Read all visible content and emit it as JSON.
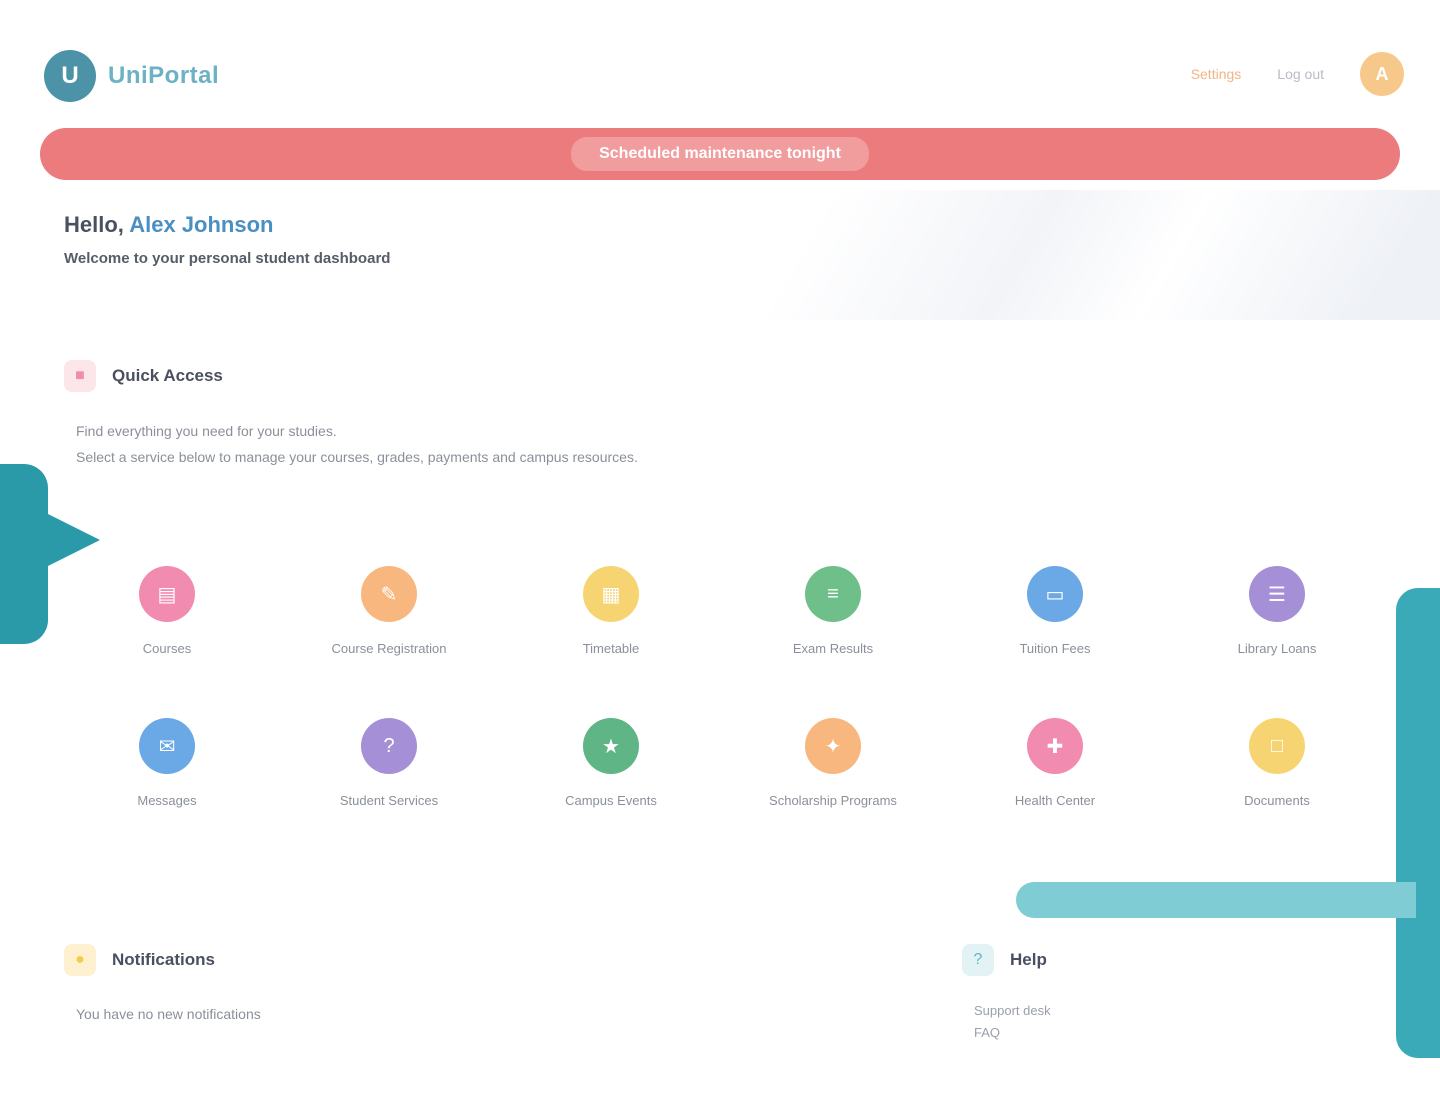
{
  "header": {
    "logo_mark": "U",
    "logo_text": "UniPortal",
    "nav": [
      "Settings",
      "Log out"
    ],
    "avatar_initial": "A"
  },
  "banner": {
    "text": "Scheduled maintenance tonight"
  },
  "hero": {
    "greeting_prefix": "Hello,",
    "greeting_name": "Alex Johnson",
    "subtitle": "Welcome to your personal student dashboard"
  },
  "services": {
    "title": "Quick Access",
    "desc_line1": "Find everything you need for your studies.",
    "desc_line2": "Select a service below to manage your courses, grades, payments and campus resources.",
    "items": [
      {
        "label": "Courses",
        "icon": "book-icon",
        "color": "#f28bb0"
      },
      {
        "label": "Course Registration",
        "icon": "edit-icon",
        "color": "#f8b77e"
      },
      {
        "label": "Timetable",
        "icon": "calendar-icon",
        "color": "#f7d472"
      },
      {
        "label": "Exam Results",
        "icon": "chart-icon",
        "color": "#6fbf8a"
      },
      {
        "label": "Tuition Fees",
        "icon": "wallet-icon",
        "color": "#6aa8e6"
      },
      {
        "label": "Library Loans",
        "icon": "library-icon",
        "color": "#a58fd6"
      },
      {
        "label": "Messages",
        "icon": "mail-icon",
        "color": "#6aa8e6"
      },
      {
        "label": "Student Services",
        "icon": "help-icon",
        "color": "#a58fd6"
      },
      {
        "label": "Campus Events",
        "icon": "event-icon",
        "color": "#5fb585"
      },
      {
        "label": "Scholarship Programs",
        "icon": "award-icon",
        "color": "#f8b77e"
      },
      {
        "label": "Health Center",
        "icon": "health-icon",
        "color": "#f28bb0"
      },
      {
        "label": "Documents",
        "icon": "document-icon",
        "color": "#f7d472"
      }
    ]
  },
  "news": {
    "title": "Notifications",
    "desc": "You have no new notifications"
  },
  "contact": {
    "title": "Help",
    "lines": [
      "Support desk",
      "FAQ"
    ]
  },
  "colors": {
    "banner": "#ec7b7d",
    "brand": "#4d93a8",
    "decoration": "#2b9aa8"
  }
}
